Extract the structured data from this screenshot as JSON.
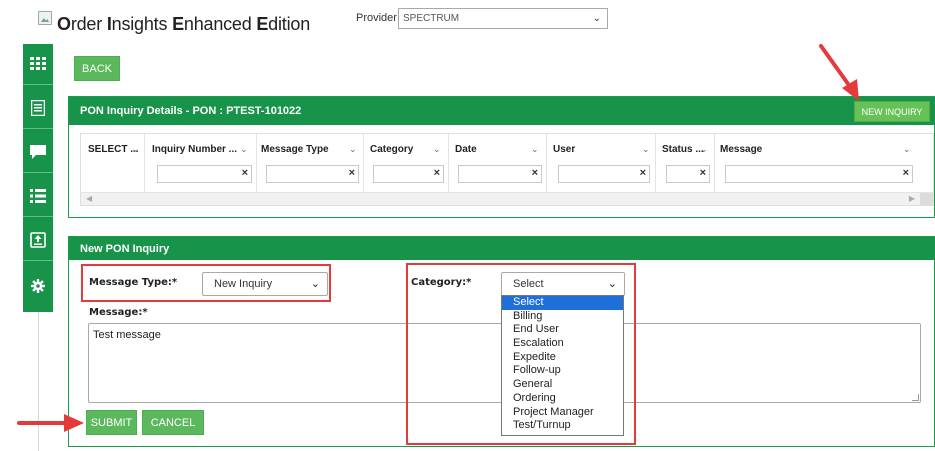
{
  "header": {
    "title_parts": [
      {
        "text": "O",
        "bold": true
      },
      {
        "text": "rder ",
        "bold": false
      },
      {
        "text": "I",
        "bold": true
      },
      {
        "text": "nsights ",
        "bold": false
      },
      {
        "text": "E",
        "bold": true
      },
      {
        "text": "nhanced ",
        "bold": false
      },
      {
        "text": "E",
        "bold": true
      },
      {
        "text": "dition",
        "bold": false
      }
    ],
    "provider_label": "Provider",
    "provider_value": "SPECTRUM"
  },
  "sidebar": {
    "icons": [
      "grid-icon",
      "list-alt-icon",
      "comment-icon",
      "menu-list-icon",
      "upload-icon",
      "settings-icon"
    ]
  },
  "back_label": "BACK",
  "inquiry_details": {
    "title": "PON Inquiry Details - PON : PTEST-101022",
    "new_inquiry_label": "NEW INQUIRY",
    "columns": [
      "SELECT ...",
      "Inquiry Number ...",
      "Message Type",
      "Category",
      "Date",
      "User",
      "Status ...",
      "Message"
    ]
  },
  "new_inquiry": {
    "title": "New PON Inquiry",
    "message_type_label": "Message Type:*",
    "message_type_value": "New Inquiry",
    "category_label": "Category:*",
    "category_value": "Select",
    "category_options": [
      "Select",
      "Billing",
      "End User",
      "Escalation",
      "Expedite",
      "Follow-up",
      "General",
      "Ordering",
      "Project Manager",
      "Test/Turnup"
    ],
    "category_highlighted": "Select",
    "message_label": "Message:*",
    "message_value": "Test message",
    "submit_label": "SUBMIT",
    "cancel_label": "CANCEL"
  },
  "colors": {
    "brand_green": "#17944a",
    "button_green": "#5cb85c",
    "annotation_red": "#e53a3a",
    "option_highlight": "#1e6fd9"
  }
}
